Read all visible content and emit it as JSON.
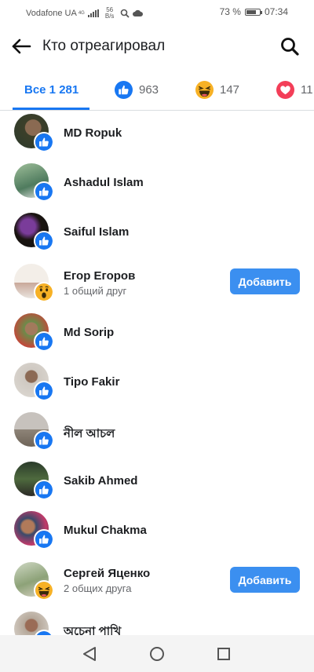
{
  "status": {
    "carrier": "Vodafone UA",
    "network": "4G",
    "speed_value": "56",
    "speed_unit": "B/s",
    "battery": "73 %",
    "battery_level": 0.73,
    "time": "07:34"
  },
  "header": {
    "title": "Кто отреагировал"
  },
  "tabs": [
    {
      "label": "Все 1 281"
    },
    {
      "count": "963",
      "icon": "like-icon"
    },
    {
      "count": "147",
      "icon": "haha-icon"
    },
    {
      "count": "11",
      "icon": "love-icon"
    }
  ],
  "people": [
    {
      "name": "MD Ropuk",
      "reaction": "like"
    },
    {
      "name": "Ashadul Islam",
      "reaction": "like"
    },
    {
      "name": "Saiful Islam",
      "reaction": "like"
    },
    {
      "name": "Егор Егоров",
      "reaction": "wow",
      "mutual": "1 общий друг",
      "button": "Добавить"
    },
    {
      "name": "Md Sorip",
      "reaction": "like"
    },
    {
      "name": "Tipo Fakir",
      "reaction": "like"
    },
    {
      "name": "নীল আচল",
      "reaction": "like"
    },
    {
      "name": "Sakib Ahmed",
      "reaction": "like"
    },
    {
      "name": "Mukul Chakma",
      "reaction": "like"
    },
    {
      "name": "Сергей Яценко",
      "reaction": "haha",
      "mutual": "2 общих друга",
      "button": "Добавить"
    },
    {
      "name": "অচেনা পাখি",
      "reaction": "like"
    }
  ],
  "colors": {
    "accent": "#1877f2",
    "like": "#1877f2",
    "love": "#f33e58",
    "haha": "#f7b125",
    "button": "#3b8ff0"
  }
}
